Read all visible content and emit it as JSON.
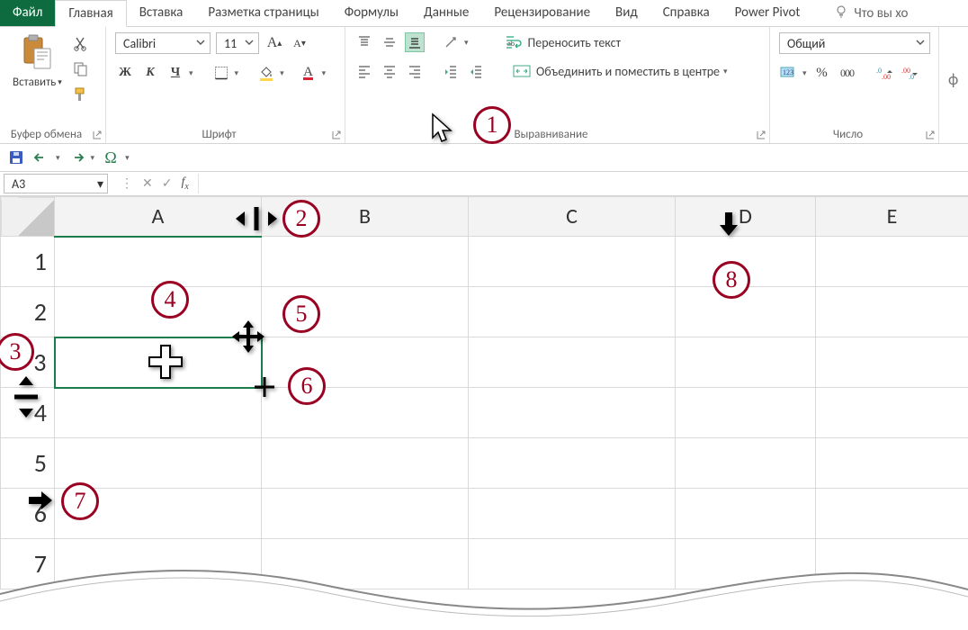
{
  "tabs": {
    "file": "Файл",
    "home": "Главная",
    "insert": "Вставка",
    "layout": "Разметка страницы",
    "formulas": "Формулы",
    "data": "Данные",
    "review": "Рецензирование",
    "view": "Вид",
    "help": "Справка",
    "powerpivot": "Power Pivot",
    "tellme": "Что вы хо"
  },
  "ribbon": {
    "clipboard": {
      "title": "Буфер обмена",
      "paste": "Вставить"
    },
    "font": {
      "title": "Шрифт",
      "name": "Calibri",
      "size": "11",
      "bold": "Ж",
      "italic": "К",
      "underline": "Ч"
    },
    "alignment": {
      "title": "Выравнивание",
      "wrap": "Переносить текст",
      "merge": "Объединить и поместить в центре"
    },
    "number": {
      "title": "Число",
      "format": "Общий",
      "percent": "%",
      "thousands": "000"
    },
    "more_indicator": "ф"
  },
  "fbar": {
    "name_box": "A3"
  },
  "columns": [
    "A",
    "B",
    "C",
    "D",
    "E"
  ],
  "rows": [
    "1",
    "2",
    "3",
    "4",
    "5",
    "6",
    "7"
  ],
  "callouts": [
    "1",
    "2",
    "3",
    "4",
    "5",
    "6",
    "7",
    "8"
  ],
  "highlight": {
    "col_index": 3,
    "row_index": 5,
    "sel_col_index": 0,
    "sel_row_index": 2
  }
}
